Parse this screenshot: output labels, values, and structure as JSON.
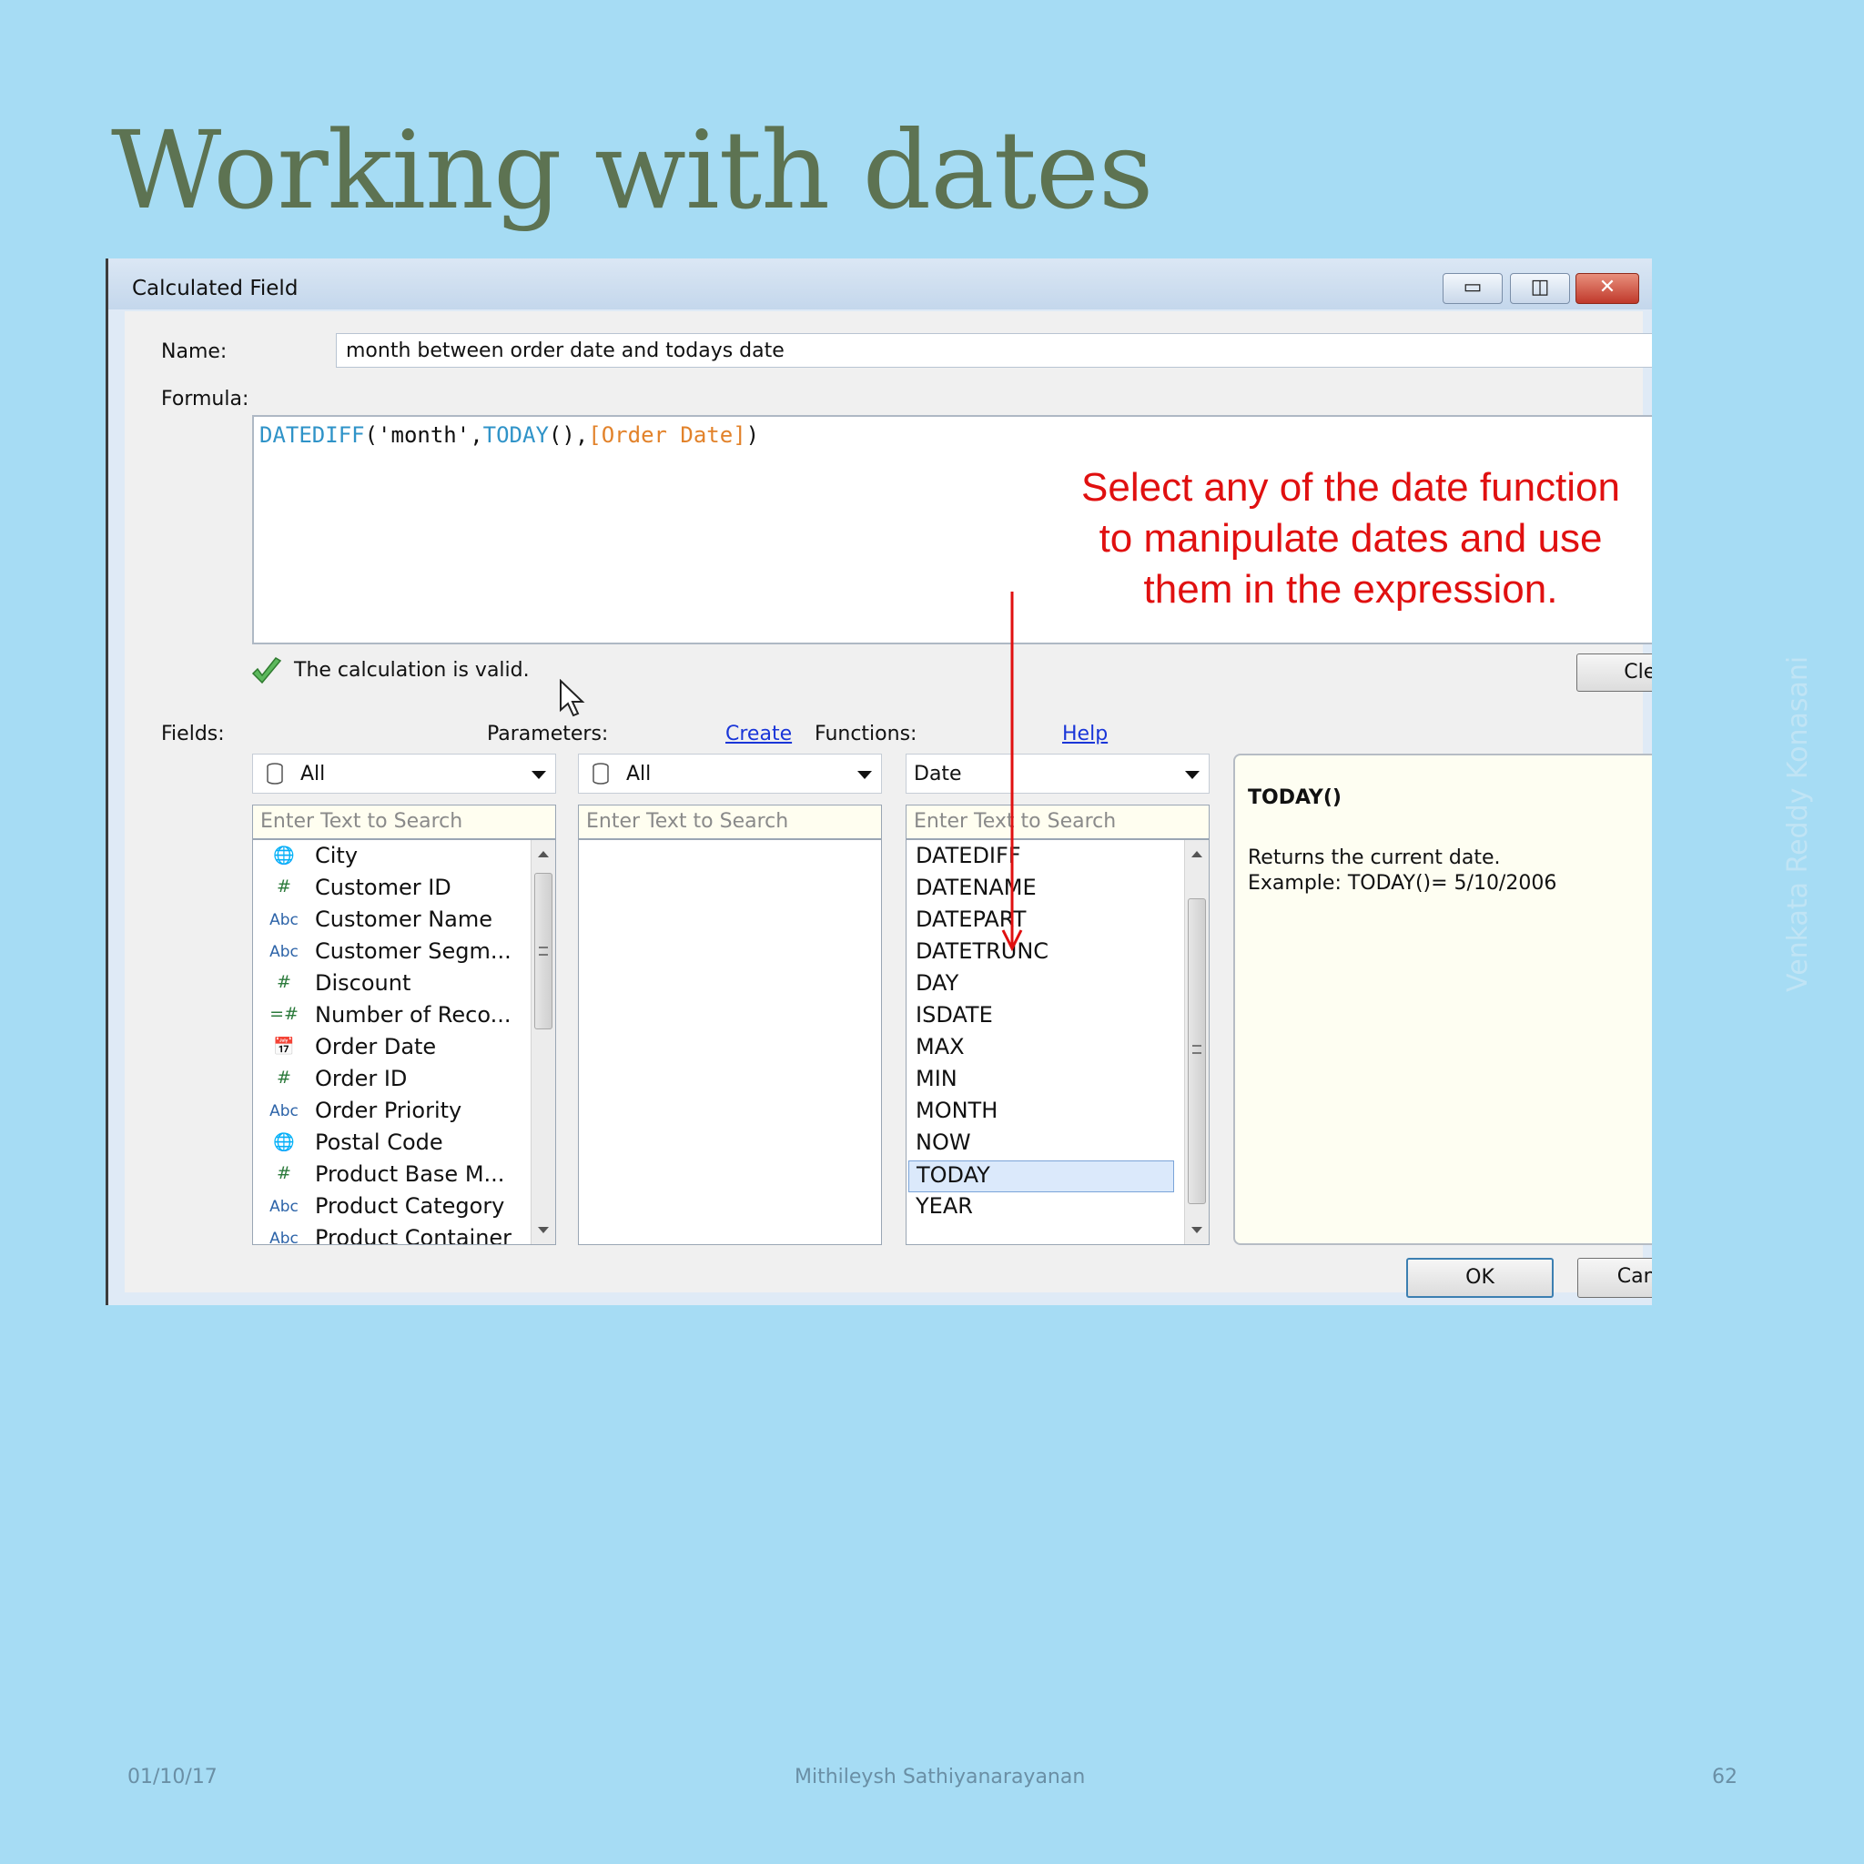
{
  "slide": {
    "title": "Working with dates",
    "footer_date": "01/10/17",
    "footer_author": "Mithileysh Sathiyanarayanan",
    "footer_page": "62",
    "watermark": "Venkata Reddy Konasani"
  },
  "dialog": {
    "title": "Calculated Field",
    "window_buttons": {
      "minimize": "▭",
      "maximize": "◫",
      "close": "✕"
    },
    "name_label": "Name:",
    "name_value": "month between order date and todays date",
    "formula_label": "Formula:",
    "formula": {
      "fn1": "DATEDIFF",
      "arg_open": "(",
      "arg1": "'month'",
      "comma1": ",",
      "fn2": "TODAY",
      "fn2_parens": "()",
      "comma2": ",",
      "field": "[Order Date]",
      "close": ")"
    },
    "annotation": {
      "line1": "Select any of the date function",
      "line2": "to manipulate dates and use",
      "line3": "them in the expression."
    },
    "validation_text": "The calculation is valid.",
    "clear_label": "Clear",
    "fields": {
      "label": "Fields:",
      "combo_value": "All",
      "search_placeholder": "Enter Text to Search",
      "items": [
        {
          "icon": "🌐",
          "text": "City"
        },
        {
          "icon": "#",
          "text": "Customer ID"
        },
        {
          "icon": "Abc",
          "text": "Customer Name"
        },
        {
          "icon": "Abc",
          "text": "Customer Segm..."
        },
        {
          "icon": "#",
          "text": "Discount"
        },
        {
          "icon": "=#",
          "text": "Number of Reco..."
        },
        {
          "icon": "📅",
          "text": "Order Date"
        },
        {
          "icon": "#",
          "text": "Order ID"
        },
        {
          "icon": "Abc",
          "text": "Order Priority"
        },
        {
          "icon": "🌐",
          "text": "Postal Code"
        },
        {
          "icon": "#",
          "text": "Product Base M..."
        },
        {
          "icon": "Abc",
          "text": "Product Category"
        },
        {
          "icon": "Abc",
          "text": "Product Container"
        }
      ]
    },
    "parameters": {
      "label": "Parameters:",
      "create_link": "Create",
      "combo_value": "All",
      "search_placeholder": "Enter Text to Search"
    },
    "functions": {
      "label": "Functions:",
      "help_link": "Help",
      "combo_value": "Date",
      "search_placeholder": "Enter Text to Search",
      "items": [
        "DATEDIFF",
        "DATENAME",
        "DATEPART",
        "DATETRUNC",
        "DAY",
        "ISDATE",
        "MAX",
        "MIN",
        "MONTH",
        "NOW",
        "TODAY",
        "YEAR"
      ],
      "selected": "TODAY"
    },
    "help_panel": {
      "heading": "TODAY()",
      "desc1": "Returns the current date.",
      "desc2": "Example: TODAY()= 5/10/2006"
    },
    "ok_label": "OK",
    "cancel_label": "Cancel"
  }
}
